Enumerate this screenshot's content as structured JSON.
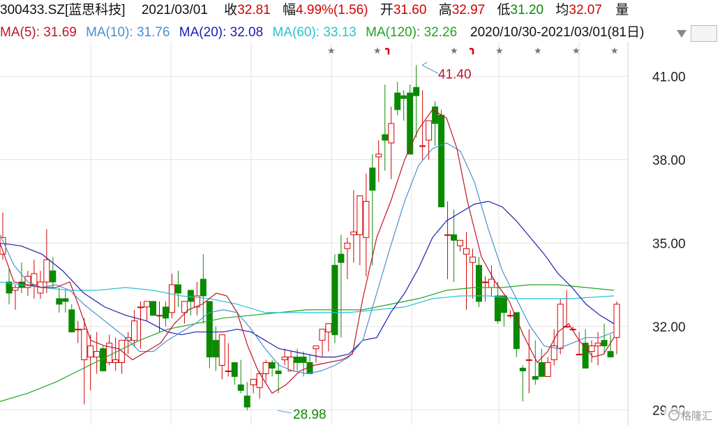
{
  "header": {
    "code": "300433.SZ[蓝思科技]",
    "date": "2021/03/01",
    "close_label": "收",
    "close": "32.81",
    "change_label": "幅",
    "change": "4.99%(1.56)",
    "open_label": "开",
    "open": "31.60",
    "high_label": "高",
    "high": "32.97",
    "low_label": "低",
    "low": "31.20",
    "avg_label": "均",
    "avg": "32.07",
    "vol_label": "量"
  },
  "ma_bar": {
    "ma5": "MA(5): 31.69",
    "ma10": "MA(10): 31.76",
    "ma20": "MA(20): 32.08",
    "ma60": "MA(60): 33.13",
    "ma120": "MA(120): 32.26",
    "range": "2020/10/30-2021/03/01(81日)",
    "menu_icon": "dropdown-triangle-icon"
  },
  "colors": {
    "up": "#d40000",
    "down": "#0a8a00",
    "ma5": "#c0142b",
    "ma10": "#4a8fd0",
    "ma20": "#1d1db0",
    "ma60": "#25c4d4",
    "ma120": "#22a322",
    "grid": "#e2e2e2"
  },
  "chart_data": {
    "type": "candlestick",
    "ylim": [
      28.7,
      42.0
    ],
    "y_ticks": [
      "41.00",
      "38.00",
      "35.00",
      "32.00",
      "29.00"
    ],
    "high_label": "41.40",
    "low_label": "28.98",
    "candles": [
      [
        34.6,
        36.1,
        34.4,
        35.2
      ],
      [
        33.6,
        34.1,
        32.8,
        33.2
      ],
      [
        33.3,
        33.5,
        32.6,
        33.4
      ],
      [
        33.6,
        34.3,
        33.2,
        33.4
      ],
      [
        33.4,
        34.0,
        33.1,
        33.8
      ],
      [
        33.5,
        34.4,
        33.0,
        33.9
      ],
      [
        33.2,
        34.0,
        33.0,
        33.6
      ],
      [
        33.6,
        35.5,
        33.2,
        34.4
      ],
      [
        34.0,
        34.5,
        33.4,
        33.6
      ],
      [
        33.0,
        33.4,
        32.5,
        32.8
      ],
      [
        33.0,
        33.3,
        32.5,
        32.9
      ],
      [
        32.6,
        32.8,
        31.9,
        31.8
      ],
      [
        31.9,
        32.2,
        31.4,
        31.9
      ],
      [
        30.8,
        32.3,
        29.2,
        31.9
      ],
      [
        30.9,
        31.7,
        29.7,
        31.3
      ],
      [
        30.9,
        31.8,
        30.3,
        31.1
      ],
      [
        31.2,
        31.3,
        30.4,
        30.4
      ],
      [
        30.7,
        31.7,
        30.6,
        31.4
      ],
      [
        30.7,
        31.6,
        30.4,
        30.8
      ],
      [
        30.7,
        31.2,
        30.3,
        31.5
      ],
      [
        31.5,
        31.8,
        31.0,
        31.6
      ],
      [
        31.5,
        32.6,
        31.3,
        32.2
      ],
      [
        32.7,
        32.9,
        31.2,
        32.7
      ],
      [
        32.7,
        32.9,
        32.2,
        32.9
      ],
      [
        32.9,
        32.8,
        32.4,
        32.4
      ],
      [
        32.4,
        32.9,
        31.8,
        32.4
      ],
      [
        32.7,
        32.9,
        32.0,
        32.3
      ],
      [
        32.5,
        33.9,
        32.3,
        33.5
      ],
      [
        33.5,
        34.0,
        32.7,
        33.2
      ],
      [
        32.5,
        32.6,
        32.1,
        32.9
      ],
      [
        33.3,
        33.2,
        32.4,
        32.9
      ],
      [
        32.7,
        33.6,
        32.4,
        33.1
      ],
      [
        33.7,
        34.6,
        32.1,
        33.1
      ],
      [
        32.9,
        32.9,
        30.5,
        30.9
      ],
      [
        31.5,
        32.0,
        30.4,
        30.9
      ],
      [
        30.6,
        31.7,
        30.1,
        31.7
      ],
      [
        30.4,
        31.4,
        30.2,
        30.4
      ],
      [
        30.7,
        30.6,
        29.9,
        30.2
      ],
      [
        29.9,
        30.8,
        29.6,
        29.7
      ],
      [
        29.5,
        30.0,
        28.98,
        29.1
      ],
      [
        29.9,
        30.1,
        29.6,
        30.1
      ],
      [
        29.8,
        30.4,
        29.4,
        30.3
      ],
      [
        30.3,
        30.8,
        30.0,
        30.7
      ],
      [
        30.7,
        30.8,
        30.2,
        30.5
      ],
      [
        30.4,
        30.7,
        29.6,
        30.3
      ],
      [
        30.8,
        31.2,
        30.6,
        30.9
      ],
      [
        30.4,
        31.1,
        30.4,
        30.9
      ],
      [
        30.9,
        31.2,
        30.4,
        30.7
      ],
      [
        30.9,
        31.1,
        30.2,
        30.7
      ],
      [
        30.7,
        31.0,
        30.3,
        30.3
      ],
      [
        31.2,
        31.2,
        30.7,
        31.3
      ],
      [
        31.5,
        31.8,
        30.9,
        31.9
      ],
      [
        31.8,
        32.0,
        31.1,
        32.1
      ],
      [
        34.2,
        34.6,
        31.4,
        31.7
      ],
      [
        34.6,
        35.3,
        31.6,
        34.3
      ],
      [
        34.8,
        35.2,
        33.7,
        35.0
      ],
      [
        35.3,
        36.9,
        34.3,
        35.4
      ],
      [
        35.3,
        36.4,
        34.2,
        36.7
      ],
      [
        35.2,
        37.5,
        33.8,
        36.5
      ],
      [
        37.7,
        38.2,
        34.2,
        36.9
      ],
      [
        38.1,
        38.7,
        37.2,
        38.2
      ],
      [
        38.9,
        40.7,
        37.6,
        38.7
      ],
      [
        38.6,
        39.9,
        37.3,
        39.3
      ],
      [
        40.4,
        40.8,
        39.6,
        39.8
      ],
      [
        40.3,
        40.5,
        39.4,
        40.2
      ],
      [
        40.4,
        40.7,
        38.4,
        38.2
      ],
      [
        40.6,
        41.4,
        38.8,
        40.3
      ],
      [
        38.5,
        40.5,
        38.0,
        38.5
      ],
      [
        38.7,
        38.8,
        38.0,
        39.4
      ],
      [
        39.9,
        40.1,
        38.5,
        39.3
      ],
      [
        39.6,
        39.8,
        38.0,
        36.3
      ],
      [
        35.3,
        36.5,
        33.7,
        35.3
      ],
      [
        35.3,
        36.2,
        33.6,
        35.1
      ],
      [
        34.9,
        35.1,
        34.7,
        35.1
      ],
      [
        34.6,
        35.4,
        32.6,
        34.8
      ],
      [
        34.3,
        34.8,
        33.0,
        34.5
      ],
      [
        34.2,
        34.5,
        32.7,
        32.9
      ],
      [
        33.6,
        33.8,
        32.9,
        33.6
      ],
      [
        33.4,
        34.2,
        33.1,
        33.7
      ],
      [
        33.1,
        33.6,
        32.1,
        32.2
      ],
      [
        33.1,
        32.5,
        32.0,
        32.5
      ],
      [
        32.4,
        32.6,
        32.3,
        32.4
      ],
      [
        32.5,
        32.4,
        30.9,
        31.2
      ],
      [
        30.5,
        30.6,
        29.3,
        30.4
      ],
      [
        30.8,
        31.9,
        29.6,
        30.8
      ],
      [
        30.2,
        31.5,
        29.9,
        30.1
      ],
      [
        30.7,
        31.2,
        30.3,
        30.2
      ],
      [
        30.2,
        30.9,
        30.2,
        30.7
      ],
      [
        30.8,
        31.9,
        30.6,
        31.3
      ],
      [
        31.2,
        33.0,
        31.0,
        32.8
      ],
      [
        32.0,
        33.3,
        32.0,
        32.0
      ],
      [
        31.9,
        32.0,
        31.9,
        31.9
      ],
      [
        31.0,
        31.8,
        31.0,
        31.0
      ],
      [
        31.4,
        31.9,
        30.7,
        30.5
      ],
      [
        31.1,
        31.5,
        30.7,
        31.3
      ],
      [
        31.3,
        31.8,
        30.6,
        31.4
      ],
      [
        31.5,
        32.1,
        31.0,
        31.3
      ],
      [
        31.1,
        31.7,
        31.0,
        30.9
      ],
      [
        31.6,
        32.9,
        31.0,
        32.8
      ]
    ],
    "ma5": [
      [
        0,
        35.0
      ],
      [
        20,
        33.6
      ],
      [
        40,
        33.5
      ],
      [
        60,
        33.4
      ],
      [
        80,
        33.4
      ],
      [
        100,
        33.6
      ],
      [
        112,
        32.8
      ],
      [
        130,
        31.5
      ],
      [
        150,
        31.3
      ],
      [
        170,
        31.2
      ],
      [
        190,
        30.8
      ],
      [
        210,
        31.1
      ],
      [
        230,
        31.4
      ],
      [
        250,
        32.1
      ],
      [
        270,
        32.6
      ],
      [
        290,
        32.8
      ],
      [
        310,
        33.2
      ],
      [
        325,
        33.1
      ],
      [
        340,
        32.5
      ],
      [
        355,
        31.3
      ],
      [
        370,
        30.4
      ],
      [
        390,
        29.6
      ],
      [
        410,
        29.9
      ],
      [
        430,
        30.4
      ],
      [
        450,
        30.6
      ],
      [
        470,
        30.7
      ],
      [
        490,
        30.8
      ],
      [
        505,
        31.0
      ],
      [
        520,
        33.0
      ],
      [
        540,
        35.2
      ],
      [
        560,
        36.5
      ],
      [
        580,
        38.0
      ],
      [
        600,
        39.1
      ],
      [
        620,
        39.8
      ],
      [
        640,
        39.5
      ],
      [
        655,
        38.4
      ],
      [
        670,
        36.5
      ],
      [
        690,
        34.5
      ],
      [
        710,
        33.6
      ],
      [
        730,
        32.9
      ],
      [
        750,
        31.7
      ],
      [
        770,
        30.7
      ],
      [
        785,
        31.1
      ],
      [
        800,
        31.8
      ],
      [
        815,
        32.1
      ],
      [
        830,
        31.5
      ],
      [
        850,
        30.9
      ],
      [
        865,
        31.0
      ],
      [
        880,
        31.6
      ]
    ],
    "ma10": [
      [
        0,
        35.3
      ],
      [
        20,
        34.2
      ],
      [
        40,
        33.6
      ],
      [
        60,
        33.4
      ],
      [
        80,
        33.5
      ],
      [
        100,
        33.3
      ],
      [
        120,
        32.8
      ],
      [
        140,
        32.4
      ],
      [
        160,
        32.0
      ],
      [
        180,
        31.6
      ],
      [
        200,
        31.1
      ],
      [
        220,
        31.1
      ],
      [
        240,
        31.5
      ],
      [
        260,
        31.8
      ],
      [
        280,
        32.1
      ],
      [
        300,
        32.5
      ],
      [
        320,
        32.6
      ],
      [
        340,
        32.5
      ],
      [
        360,
        31.9
      ],
      [
        380,
        31.2
      ],
      [
        400,
        30.6
      ],
      [
        420,
        30.4
      ],
      [
        440,
        30.3
      ],
      [
        460,
        30.4
      ],
      [
        480,
        30.6
      ],
      [
        500,
        30.9
      ],
      [
        520,
        31.5
      ],
      [
        540,
        33.2
      ],
      [
        560,
        34.9
      ],
      [
        580,
        36.5
      ],
      [
        600,
        37.8
      ],
      [
        620,
        38.4
      ],
      [
        640,
        38.6
      ],
      [
        660,
        38.3
      ],
      [
        680,
        37.2
      ],
      [
        700,
        35.5
      ],
      [
        720,
        34.0
      ],
      [
        740,
        33.0
      ],
      [
        760,
        32.0
      ],
      [
        780,
        31.3
      ],
      [
        800,
        31.2
      ],
      [
        820,
        31.4
      ],
      [
        840,
        31.6
      ],
      [
        860,
        31.6
      ],
      [
        880,
        31.8
      ]
    ],
    "ma20": [
      [
        0,
        35.0
      ],
      [
        30,
        34.9
      ],
      [
        60,
        34.6
      ],
      [
        90,
        34.0
      ],
      [
        120,
        33.2
      ],
      [
        150,
        32.7
      ],
      [
        180,
        32.4
      ],
      [
        210,
        32.2
      ],
      [
        240,
        31.8
      ],
      [
        260,
        31.7
      ],
      [
        280,
        31.8
      ],
      [
        300,
        31.8
      ],
      [
        320,
        31.8
      ],
      [
        340,
        31.9
      ],
      [
        360,
        31.8
      ],
      [
        380,
        31.5
      ],
      [
        400,
        31.2
      ],
      [
        420,
        31.1
      ],
      [
        440,
        31.0
      ],
      [
        460,
        30.9
      ],
      [
        480,
        30.9
      ],
      [
        500,
        31.0
      ],
      [
        520,
        31.5
      ],
      [
        540,
        31.6
      ],
      [
        560,
        32.5
      ],
      [
        580,
        33.2
      ],
      [
        600,
        34.1
      ],
      [
        620,
        35.2
      ],
      [
        640,
        35.8
      ],
      [
        660,
        36.1
      ],
      [
        680,
        36.4
      ],
      [
        700,
        36.5
      ],
      [
        720,
        36.3
      ],
      [
        740,
        35.8
      ],
      [
        760,
        35.2
      ],
      [
        780,
        34.6
      ],
      [
        800,
        33.9
      ],
      [
        820,
        33.4
      ],
      [
        840,
        32.8
      ],
      [
        860,
        32.4
      ],
      [
        880,
        32.1
      ]
    ],
    "ma60": [
      [
        0,
        33.6
      ],
      [
        60,
        33.4
      ],
      [
        100,
        33.3
      ],
      [
        140,
        33.3
      ],
      [
        180,
        33.4
      ],
      [
        220,
        33.3
      ],
      [
        260,
        33.1
      ],
      [
        300,
        33.0
      ],
      [
        340,
        32.8
      ],
      [
        380,
        32.5
      ],
      [
        420,
        32.5
      ],
      [
        460,
        32.5
      ],
      [
        500,
        32.5
      ],
      [
        540,
        32.6
      ],
      [
        580,
        32.7
      ],
      [
        620,
        33.0
      ],
      [
        660,
        33.1
      ],
      [
        700,
        33.1
      ],
      [
        740,
        33.0
      ],
      [
        780,
        33.0
      ],
      [
        820,
        33.0
      ],
      [
        880,
        33.1
      ]
    ],
    "ma120": [
      [
        0,
        29.3
      ],
      [
        40,
        29.6
      ],
      [
        80,
        30.0
      ],
      [
        120,
        30.5
      ],
      [
        160,
        31.0
      ],
      [
        200,
        31.5
      ],
      [
        240,
        31.9
      ],
      [
        280,
        32.1
      ],
      [
        320,
        32.3
      ],
      [
        360,
        32.4
      ],
      [
        400,
        32.5
      ],
      [
        440,
        32.6
      ],
      [
        480,
        32.6
      ],
      [
        520,
        32.6
      ],
      [
        560,
        32.8
      ],
      [
        600,
        33.0
      ],
      [
        640,
        33.3
      ],
      [
        680,
        33.4
      ],
      [
        720,
        33.4
      ],
      [
        760,
        33.5
      ],
      [
        800,
        33.5
      ],
      [
        840,
        33.4
      ],
      [
        880,
        33.3
      ]
    ]
  }
}
